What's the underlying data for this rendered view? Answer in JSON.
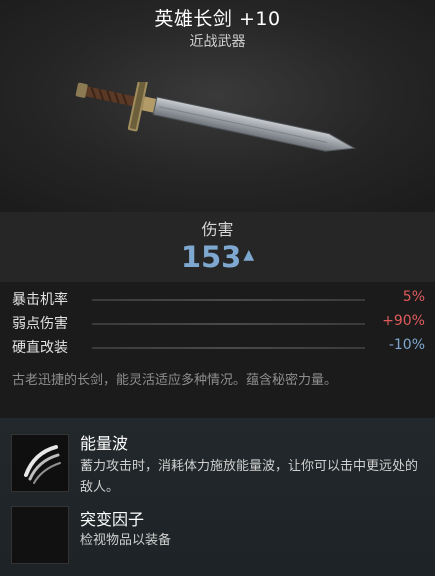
{
  "item": {
    "title": "英雄长剑 +10",
    "category": "近战武器"
  },
  "damage": {
    "label": "伤害",
    "value": "153",
    "trend": "up"
  },
  "stats": [
    {
      "name": "暴击机率",
      "value": "5%",
      "color": "#e05b5b"
    },
    {
      "name": "弱点伤害",
      "value": "+90%",
      "color": "#e05b5b"
    },
    {
      "name": "硬直改装",
      "value": "-10%",
      "color": "#7fa8d0"
    }
  ],
  "description": "古老迅捷的长剑，能灵活适应多种情况。蕴含秘密力量。",
  "abilities": [
    {
      "name": "能量波",
      "text": "蓄力攻击时，消耗体力施放能量波，让你可以击中更远处的敌人。",
      "icon": "energy-wave-icon"
    },
    {
      "name": "突变因子",
      "text": "检视物品以装备",
      "icon": "empty-slot-icon"
    }
  ]
}
